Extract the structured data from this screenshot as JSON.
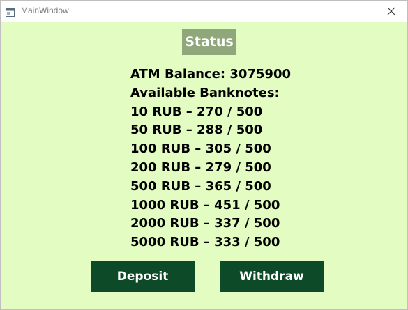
{
  "window": {
    "title": "MainWindow"
  },
  "status": {
    "title": "Status",
    "balance_line": "ATM Balance: 3075900",
    "banknotes_header": "Available Banknotes:",
    "banknotes": [
      "10 RUB – 270 / 500",
      "50 RUB – 288 / 500",
      "100 RUB – 305 / 500",
      "200 RUB – 279 / 500",
      "500 RUB – 365 / 500",
      "1000 RUB – 451 / 500",
      "2000 RUB – 337 / 500",
      "5000 RUB – 333 / 500"
    ]
  },
  "actions": {
    "deposit_label": "Deposit",
    "withdraw_label": "Withdraw"
  },
  "colors": {
    "background": "#e2fcc2",
    "status_badge": "#8fa77a",
    "button": "#0d4a27"
  },
  "icons": {
    "app": "window-app-icon",
    "close": "close-icon"
  }
}
